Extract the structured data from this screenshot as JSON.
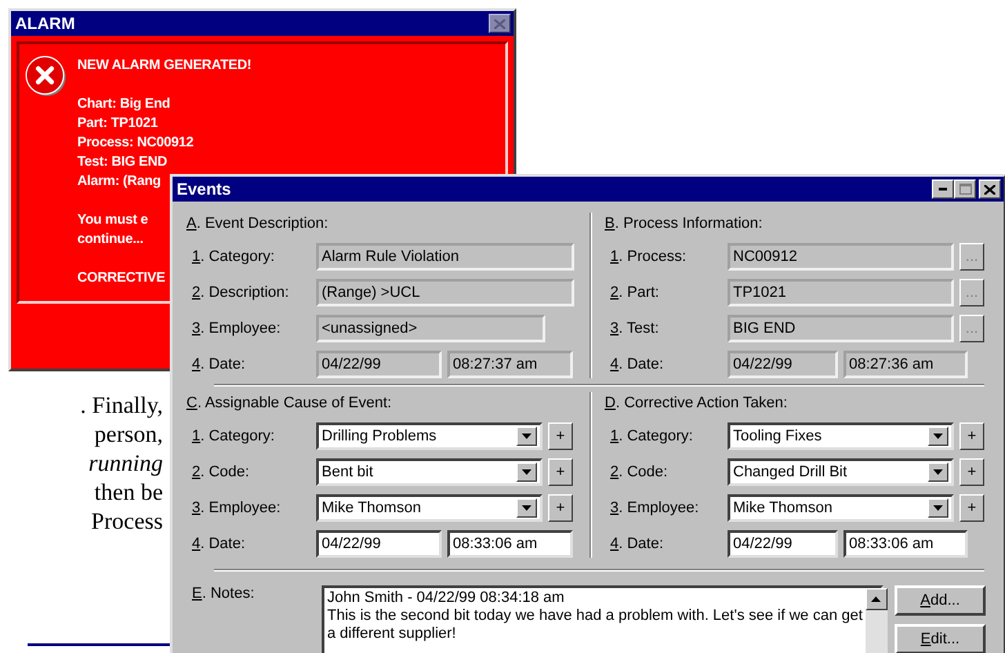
{
  "document_text": [
    {
      "text": ". Finally,",
      "italic": false
    },
    {
      "text": "person,",
      "italic": false
    },
    {
      "text": "running",
      "italic": true
    },
    {
      "text": "then be",
      "italic": false
    },
    {
      "text": "Process",
      "italic": false
    }
  ],
  "alarm_window": {
    "title": "ALARM",
    "heading": "NEW ALARM GENERATED!",
    "details": [
      "Chart: Big End",
      "Part: TP1021",
      "Process: NC00912",
      "Test: BIG END",
      "Alarm: (Rang"
    ],
    "message": [
      "You must e",
      "continue..."
    ],
    "footer": "CORRECTIVE"
  },
  "events_window": {
    "title": "Events",
    "sections": [
      {
        "heading": "A. Event Description:",
        "editable": false,
        "rows": [
          {
            "kind": "text",
            "label": "1. Category:",
            "value": "Alarm Rule Violation"
          },
          {
            "kind": "text",
            "label": "2. Description:",
            "value": "(Range) >UCL"
          },
          {
            "kind": "short",
            "label": "3. Employee:",
            "value": "<unassigned>"
          },
          {
            "kind": "date",
            "label": "4. Date:",
            "value": "04/22/99",
            "time": "08:27:37 am"
          }
        ]
      },
      {
        "heading": "B. Process Information:",
        "editable": false,
        "rows": [
          {
            "kind": "browse",
            "label": "1. Process:",
            "value": "NC00912",
            "button": "..."
          },
          {
            "kind": "browse",
            "label": "2. Part:",
            "value": "TP1021",
            "button": "..."
          },
          {
            "kind": "browse",
            "label": "3. Test:",
            "value": "BIG END",
            "button": "..."
          },
          {
            "kind": "date",
            "label": "4. Date:",
            "value": "04/22/99",
            "time": "08:27:36 am"
          }
        ]
      },
      {
        "heading": "C. Assignable Cause of Event:",
        "editable": true,
        "rows": [
          {
            "kind": "combo",
            "label": "1. Category:",
            "value": "Drilling Problems",
            "button": "+"
          },
          {
            "kind": "combo",
            "label": "2. Code:",
            "value": "Bent bit",
            "button": "+"
          },
          {
            "kind": "combo",
            "label": "3. Employee:",
            "value": "Mike Thomson",
            "button": "+"
          },
          {
            "kind": "date",
            "label": "4. Date:",
            "value": "04/22/99",
            "time": "08:33:06 am"
          }
        ]
      },
      {
        "heading": "D. Corrective Action Taken:",
        "editable": true,
        "rows": [
          {
            "kind": "combo",
            "label": "1. Category:",
            "value": "Tooling Fixes",
            "button": "+"
          },
          {
            "kind": "combo",
            "label": "2. Code:",
            "value": "Changed Drill Bit",
            "button": "+"
          },
          {
            "kind": "combo",
            "label": "3. Employee:",
            "value": "Mike Thomson",
            "button": "+"
          },
          {
            "kind": "date",
            "label": "4. Date:",
            "value": "04/22/99",
            "time": "08:33:06 am"
          }
        ]
      }
    ],
    "notes": {
      "label": "E. Notes:",
      "lines": [
        "John Smith - 04/22/99 08:34:18 am",
        "This is the second bit today we have had a problem with. Let's see if we can get",
        "a different supplier!"
      ],
      "buttons": [
        "Add...",
        "Edit..."
      ]
    }
  }
}
